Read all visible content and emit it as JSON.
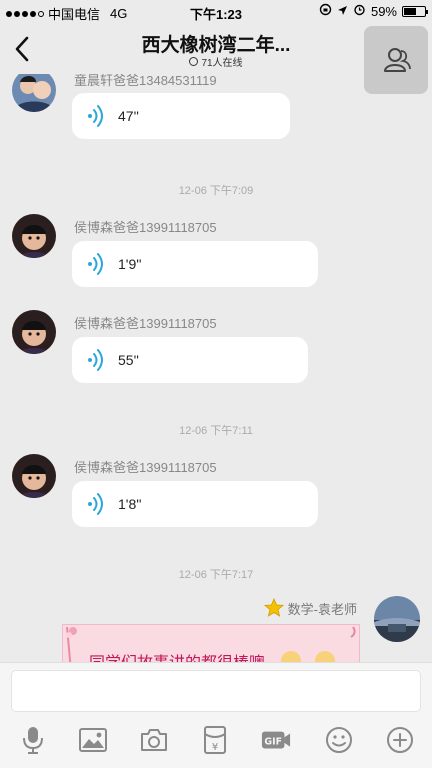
{
  "status_bar": {
    "carrier": "中国电信",
    "network": "4G",
    "time": "下午1:23",
    "battery": "59%",
    "battery_level": 0.59
  },
  "nav": {
    "title": "西大橡树湾二年...",
    "online": "71人在线"
  },
  "messages": [
    {
      "sender": "童晨轩爸爸13484531119",
      "duration": "47''"
    },
    {
      "sender": "侯博森爸爸13991118705",
      "duration": "1'9''"
    },
    {
      "sender": "侯博森爸爸13991118705",
      "duration": "55''"
    },
    {
      "sender": "侯博森爸爸13991118705",
      "duration": "1'8''"
    }
  ],
  "timestamps": [
    "12-06 下午7:09",
    "12-06 下午7:11",
    "12-06 下午7:17"
  ],
  "self_message": {
    "sender": "数学-袁老师",
    "card_text": "同学们故事讲的都很棒噢"
  },
  "toolbar_icons": [
    "microphone-icon",
    "image-icon",
    "camera-icon",
    "red-packet-icon",
    "gif-icon",
    "emoji-icon",
    "plus-icon"
  ]
}
